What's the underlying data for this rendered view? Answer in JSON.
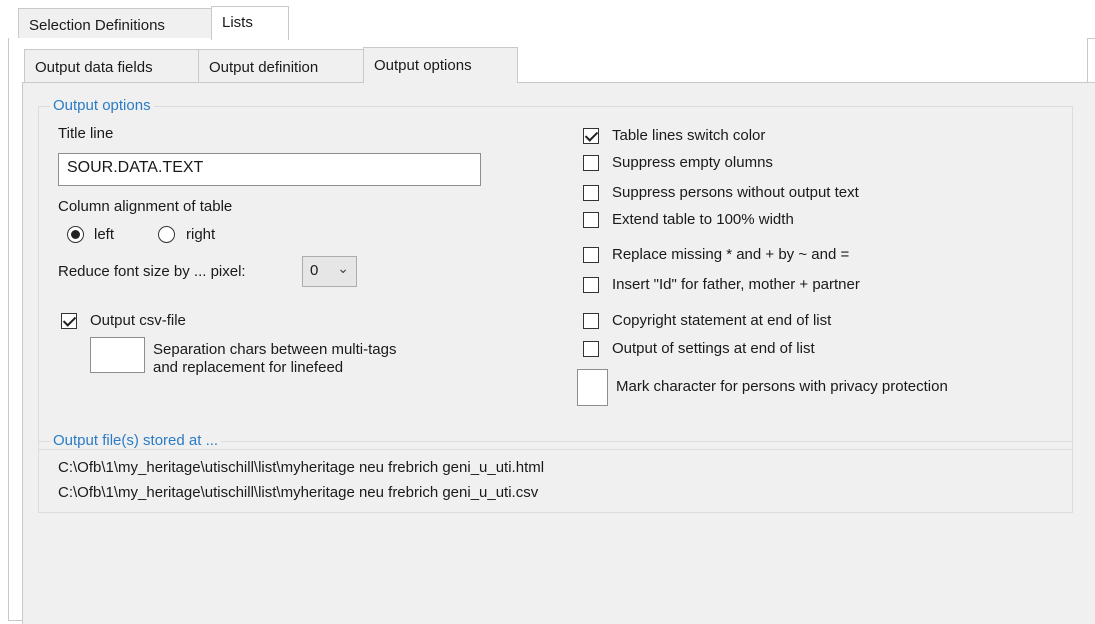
{
  "outer_tabs": [
    {
      "label": "Selection Definitions",
      "active": false
    },
    {
      "label": "Lists",
      "active": true
    }
  ],
  "inner_tabs": [
    {
      "label": "Output data fields",
      "active": false
    },
    {
      "label": "Output definition",
      "active": false
    },
    {
      "label": "Output options",
      "active": true
    }
  ],
  "output_options": {
    "legend": "Output options",
    "title_line_label": "Title line",
    "title_line_value": "SOUR.DATA.TEXT",
    "column_alignment_label": "Column alignment of table",
    "align_left_label": "left",
    "align_right_label": "right",
    "align_selected": "left",
    "reduce_font_label": "Reduce font size by ... pixel:",
    "reduce_font_value": "0",
    "csv_label": "Output csv-file",
    "csv_checked": true,
    "separation_value": "",
    "separation_label_1": "Separation chars between multi-tags",
    "separation_label_2": "and replacement for linefeed",
    "table_lines_label": "Table lines switch color",
    "table_lines_checked": true,
    "suppress_empty_label": "Suppress empty olumns",
    "suppress_empty_checked": false,
    "suppress_persons_label": "Suppress persons without output text",
    "suppress_persons_checked": false,
    "extend_table_label": "Extend table to 100% width",
    "extend_table_checked": false,
    "replace_missing_label": "Replace missing * and + by ~ and =",
    "replace_missing_checked": false,
    "insert_id_label": "Insert \"Id\" for father, mother + partner",
    "insert_id_checked": false,
    "copyright_label": "Copyright statement at end of list",
    "copyright_checked": false,
    "settings_label": "Output of settings at end of list",
    "settings_checked": false,
    "mark_char_value": "",
    "mark_char_label": "Mark character for persons with privacy protection"
  },
  "output_files": {
    "legend": "Output file(s) stored at ...",
    "paths": [
      "C:\\Ofb\\1\\my_heritage\\utischill\\list\\myheritage neu frebrich geni_u_uti.html",
      "C:\\Ofb\\1\\my_heritage\\utischill\\list\\myheritage neu frebrich geni_u_uti.csv"
    ]
  },
  "colors": {
    "legend": "#2b7cc4",
    "panel": "#f0f0f0"
  }
}
